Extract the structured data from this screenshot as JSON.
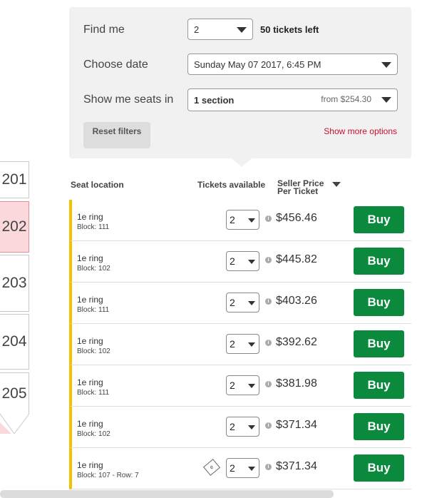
{
  "map": {
    "sections": [
      "201",
      "202",
      "203",
      "204",
      "205"
    ],
    "selected_section": "202"
  },
  "filters": {
    "find_me": {
      "label": "Find me",
      "value": "2",
      "tickets_left": "50 tickets left"
    },
    "choose_date": {
      "label": "Choose date",
      "value": "Sunday May 07 2017, 6:45 PM"
    },
    "show_seats": {
      "label": "Show me seats in",
      "value": "1 section",
      "from": "from $254.30"
    },
    "reset_label": "Reset filters",
    "more_label": "Show more options"
  },
  "table": {
    "headers": {
      "seat_location": "Seat location",
      "tickets_available": "Tickets available",
      "seller_price_line1": "Seller Price",
      "seller_price_line2": "Per Ticket"
    },
    "rows": [
      {
        "location": "1e ring",
        "block": "Block: 111",
        "qty": "2",
        "price": "$456.46",
        "buy": "Buy"
      },
      {
        "location": "1e ring",
        "block": "Block: 102",
        "qty": "2",
        "price": "$445.82",
        "buy": "Buy"
      },
      {
        "location": "1e ring",
        "block": "Block: 111",
        "qty": "2",
        "price": "$403.26",
        "buy": "Buy"
      },
      {
        "location": "1e ring",
        "block": "Block: 102",
        "qty": "2",
        "price": "$392.62",
        "buy": "Buy"
      },
      {
        "location": "1e ring",
        "block": "Block: 111",
        "qty": "2",
        "price": "$381.98",
        "buy": "Buy"
      },
      {
        "location": "1e ring",
        "block": "Block: 102",
        "qty": "2",
        "price": "$371.34",
        "buy": "Buy"
      },
      {
        "location": "1e ring",
        "block": "Block: 107 - Row: 7",
        "qty": "2",
        "price": "$371.34",
        "buy": "Buy",
        "eticket_icon": "e-ticket-icon"
      }
    ]
  },
  "colors": {
    "accent_green": "#0b8a3e",
    "row_marker": "#f2c200",
    "link_red": "#c8102e",
    "selected_section": "#fbd8db"
  }
}
